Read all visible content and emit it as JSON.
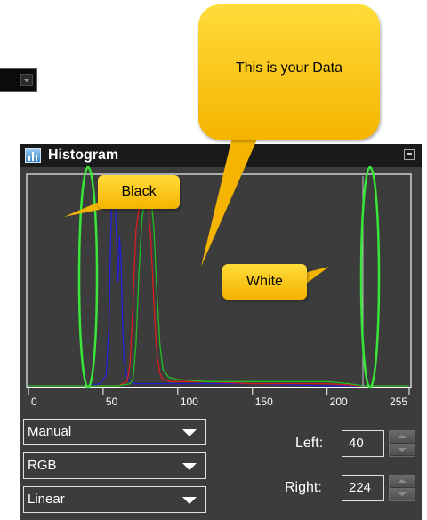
{
  "top_dropdown": {
    "value": ""
  },
  "panel": {
    "title": "Histogram",
    "icon": "histogram-icon",
    "x_ticks": [
      "0",
      "50",
      "100",
      "150",
      "200",
      "255"
    ]
  },
  "histogram": {
    "x_range": [
      0,
      255
    ],
    "left_marker": 40,
    "right_marker": 224,
    "series": [
      {
        "color": "#1e1ed8",
        "x": [
          0,
          40,
          48,
          52,
          54,
          55,
          56,
          57,
          58,
          59,
          60,
          61,
          62,
          63,
          64,
          66,
          68,
          72,
          80,
          100,
          150,
          200,
          224,
          255
        ],
        "y": [
          0,
          0,
          1,
          5,
          30,
          70,
          92,
          96,
          88,
          70,
          50,
          72,
          60,
          30,
          12,
          4,
          2,
          1,
          1,
          1,
          1,
          0,
          0,
          0
        ]
      },
      {
        "color": "#d81e1e",
        "x": [
          0,
          60,
          66,
          68,
          70,
          72,
          74,
          76,
          78,
          80,
          82,
          84,
          86,
          88,
          90,
          95,
          100,
          120,
          150,
          200,
          224,
          255
        ],
        "y": [
          0,
          0,
          2,
          10,
          40,
          75,
          85,
          92,
          96,
          88,
          70,
          40,
          15,
          6,
          3,
          2,
          2,
          2,
          1,
          1,
          0,
          0
        ]
      },
      {
        "color": "#20c020",
        "x": [
          0,
          60,
          68,
          70,
          72,
          74,
          76,
          78,
          80,
          82,
          84,
          86,
          88,
          90,
          94,
          100,
          120,
          150,
          200,
          215,
          224,
          255
        ],
        "y": [
          0,
          0,
          1,
          3,
          20,
          55,
          80,
          90,
          97,
          92,
          75,
          45,
          20,
          8,
          4,
          3,
          2,
          2,
          2,
          1,
          0,
          0
        ]
      }
    ]
  },
  "controls": {
    "mode": "Manual",
    "channel": "RGB",
    "scale": "Linear",
    "left_label": "Left:",
    "left_value": "40",
    "right_label": "Right:",
    "right_value": "224"
  },
  "callouts": {
    "black": "Black",
    "white": "White",
    "data": "This is your Data",
    "fill": "#f5b400"
  },
  "highlight_color": "#39e639"
}
